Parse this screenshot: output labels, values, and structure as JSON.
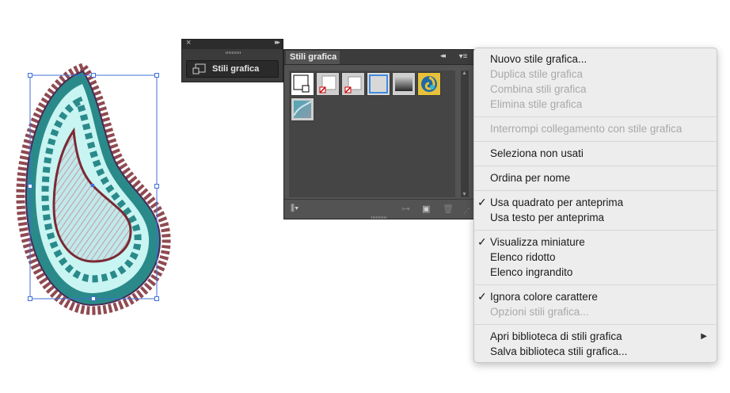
{
  "mini_panel": {
    "title": "Stili grafica"
  },
  "panel": {
    "tab_label": "Stili grafica",
    "swatches": [
      "default-style",
      "style-red-slash-1",
      "style-red-slash-2",
      "style-blue-outline",
      "style-gray-gradient",
      "style-swirl",
      "style-teal-paint"
    ]
  },
  "menu": {
    "new_style": "Nuovo stile grafica...",
    "duplicate": "Duplica stile grafica",
    "merge": "Combina stili grafica",
    "delete": "Elimina stile grafica",
    "break_link": "Interrompi collegamento con stile grafica",
    "select_unused": "Seleziona non usati",
    "sort_name": "Ordina per nome",
    "use_square": "Usa quadrato per anteprima",
    "use_text": "Usa testo per anteprima",
    "thumbnail": "Visualizza miniature",
    "small_list": "Elenco ridotto",
    "large_list": "Elenco ingrandito",
    "override_color": "Ignora colore carattere",
    "options": "Opzioni stili grafica...",
    "open_library": "Apri biblioteca di stili grafica",
    "save_library": "Salva biblioteca stili grafica...",
    "checked": [
      "use_square",
      "thumbnail",
      "override_color"
    ]
  },
  "colors": {
    "panel_bg": "#535353",
    "menu_bg": "#ededed",
    "selection_blue": "#3f6fd8",
    "paisley_outline": "#7b2a33",
    "paisley_teal": "#2a8a8a",
    "paisley_light": "#c8f4f2"
  }
}
